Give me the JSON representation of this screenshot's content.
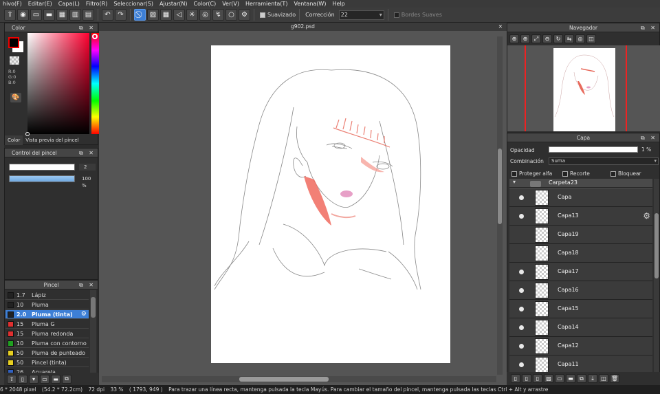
{
  "menu": [
    "hivo(F)",
    "Editar(E)",
    "Capa(L)",
    "Filtro(R)",
    "Seleccionar(S)",
    "Ajustar(N)",
    "Color(C)",
    "Ver(V)",
    "Herramienta(T)",
    "Ventana(W)",
    "Help"
  ],
  "toolbar": {
    "smoothing_label": "Suavizado",
    "correction_label": "Corrección",
    "correction_value": "22",
    "soft_edges_label": "Bordes Suaves"
  },
  "color_panel": {
    "title": "Color",
    "rgb": [
      "R:0",
      "G:0",
      "B:0"
    ],
    "tabs": [
      "Color",
      "Vista previa del pincel"
    ],
    "foreground": "#000000",
    "background": "#ffffff"
  },
  "brush_control": {
    "title": "Control del pincel",
    "size_value": "2",
    "opacity_value": "100 %"
  },
  "brush_panel": {
    "title": "Pincel",
    "items": [
      {
        "size": "1.7",
        "name": "Lápiz",
        "color": "#222222"
      },
      {
        "size": "10",
        "name": "Pluma",
        "color": "#222222"
      },
      {
        "size": "2.0",
        "name": "Pluma (tinta)",
        "color": "#222222",
        "selected": true
      },
      {
        "size": "15",
        "name": "Pluma G",
        "color": "#e03030"
      },
      {
        "size": "15",
        "name": "Pluma redonda",
        "color": "#e03030"
      },
      {
        "size": "10",
        "name": "Pluma con contorno",
        "color": "#20a020"
      },
      {
        "size": "50",
        "name": "Pluma de punteado",
        "color": "#e8d020"
      },
      {
        "size": "50",
        "name": "Pincel (tinta)",
        "color": "#e8d020"
      },
      {
        "size": "26",
        "name": "Acuarela",
        "color": "#3060c0"
      }
    ]
  },
  "document": {
    "tab_title": "g902.psd"
  },
  "navigator": {
    "title": "Navegador"
  },
  "layer_panel": {
    "title": "Capa",
    "opacity_label": "Opacidad",
    "opacity_value": "1 %",
    "blend_label": "Combinación",
    "blend_value": "Suma",
    "protect_alpha": "Proteger alfa",
    "clipping": "Recorte",
    "lock": "Bloquear",
    "folder_name": "Carpeta23",
    "layers": [
      {
        "name": "Capa",
        "visible": true
      },
      {
        "name": "Capa13",
        "visible": true,
        "active": true
      },
      {
        "name": "Capa19",
        "visible": false
      },
      {
        "name": "Capa18",
        "visible": false
      },
      {
        "name": "Capa17",
        "visible": true
      },
      {
        "name": "Capa16",
        "visible": true
      },
      {
        "name": "Capa15",
        "visible": true
      },
      {
        "name": "Capa14",
        "visible": true
      },
      {
        "name": "Capa12",
        "visible": true
      },
      {
        "name": "Capa11",
        "visible": true
      }
    ]
  },
  "status": {
    "size": "6 * 2048 pixel",
    "physical": "(54.2 * 72.2cm)",
    "dpi": "72 dpi",
    "zoom": "33 %",
    "cursor": "( 1793, 949 )",
    "hint": "Para trazar una línea recta, mantenga pulsada la tecla Mayús. Para cambiar el tamaño del pincel, mantenga pulsada las teclas Ctrl + Alt y arrastre"
  },
  "colors": {
    "accent": "#3d7fd6",
    "panel": "#2f2f2f",
    "sketch_red": "#e86a5c"
  }
}
